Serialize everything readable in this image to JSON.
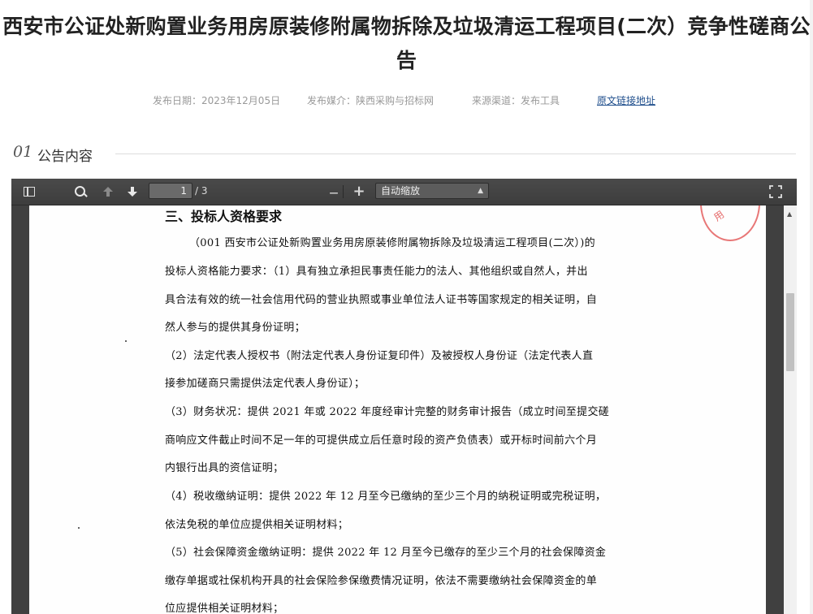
{
  "article": {
    "title_line1": "西安市公证处新购置业务用房原装修附属物拆除及垃圾清运工程项目(二次）竞争性磋商公",
    "title_line2": "告"
  },
  "meta": {
    "date": "发布日期：2023年12月05日",
    "media": "发布媒介：陕西采购与招标网",
    "channel": "来源渠道：发布工具",
    "source_link": "原文链接地址"
  },
  "section": {
    "number": "01",
    "label": "公告内容"
  },
  "viewer": {
    "toolbar": {
      "page_current": "1",
      "page_total": "/ 3",
      "zoom_out": "—",
      "zoom_in": "+",
      "zoom_label": "自动缩放",
      "icons": [
        "sidebar-toggle-icon",
        "search-icon",
        "arrow-up-icon",
        "arrow-down-icon",
        "zoom-out-icon",
        "zoom-in-icon",
        "fullscreen-icon"
      ]
    },
    "document": {
      "stamp_text": "用",
      "heading": "三、投标人资格要求",
      "lines": [
        "（001 西安市公证处新购置业务用房原装修附属物拆除及垃圾清运工程项目(二次）)的",
        "投标人资格能力要求：（1）具有独立承担民事责任能力的法人、其他组织或自然人，并出",
        "具合法有效的统一社会信用代码的营业执照或事业单位法人证书等国家规定的相关证明，自",
        "然人参与的提供其身份证明；",
        "（2）法定代表人授权书（附法定代表人身份证复印件）及被授权人身份证（法定代表人直",
        "接参加磋商只需提供法定代表人身份证）；",
        "（3）财务状况：提供 2021 年或 2022 年度经审计完整的财务审计报告（成立时间至提交磋",
        "商响应文件截止时间不足一年的可提供成立后任意时段的资产负债表）或开标时间前六个月",
        "内银行出具的资信证明；",
        "（4）税收缴纳证明：提供 2022 年 12 月至今已缴纳的至少三个月的纳税证明或完税证明，",
        "依法免税的单位应提供相关证明材料；",
        "（5）社会保障资金缴纳证明：提供 2022 年 12 月至今已缴存的至少三个月的社会保障资金",
        "缴存单据或社保机构开具的社会保险参保缴费情况证明，依法不需要缴纳社会保障资金的单",
        "位应提供相关证明材料；"
      ]
    }
  },
  "colors": {
    "toolbar_bg": "#404040",
    "link": "#1f4e8c",
    "stamp": "#e04a4a"
  }
}
